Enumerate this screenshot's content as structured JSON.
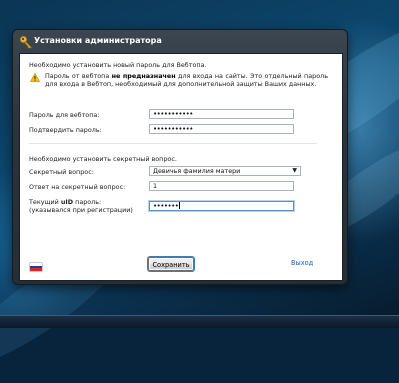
{
  "window": {
    "title": "Установки администратора",
    "title_icon": "key-icon"
  },
  "form": {
    "intro": "Необходимо установить новый пароль для Вебтопа.",
    "warning": {
      "icon": "warning-icon",
      "before": "Пароль от вебтопа",
      "bold": "не предназначен",
      "after": "для входа на сайты. Это отдельный пароль для входа в Вебтоп, необходимый для дополнительной защиты Ваших данных."
    },
    "webtop_password_label": "Пароль для вебтопа:",
    "webtop_password_value": "•••••••••••",
    "confirm_password_label": "Подтвердить пароль:",
    "confirm_password_value": "•••••••••••",
    "secret_intro": "Необходимо установить секретный вопрос.",
    "secret_question_label": "Секретный вопрос:",
    "secret_question_value": "Девичья фамилия матери",
    "secret_answer_label": "Ответ на секретный вопрос:",
    "secret_answer_value": "1",
    "current_password_label_prefix": "Текущий",
    "current_password_label_bold": "uID",
    "current_password_label_suffix": "пароль:",
    "current_password_hint": "(указывался при регистрации)",
    "current_password_value": "•••••••"
  },
  "footer": {
    "language_flag": "russian-flag",
    "save_label": "Сохранить",
    "exit_label": "Выход"
  },
  "colors": {
    "link": "#1a5ea8",
    "focus_border": "#5e8fc4",
    "warning_yellow": "#f5c400"
  }
}
